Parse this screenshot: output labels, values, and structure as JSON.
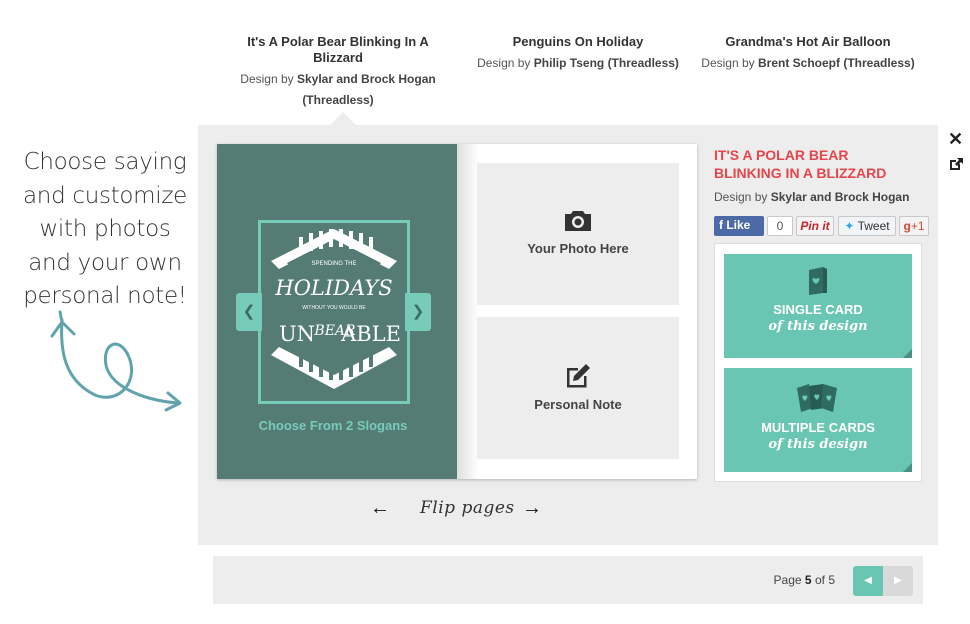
{
  "designs": [
    {
      "title": "It's A Polar Bear Blinking In A Blizzard",
      "by_prefix": "Design by",
      "designer": "Skylar and Brock Hogan (Threadless)"
    },
    {
      "title": "Penguins On Holiday",
      "by_prefix": "Design by",
      "designer": "Philip Tseng (Threadless)"
    },
    {
      "title": "Grandma's Hot Air Balloon",
      "by_prefix": "Design by",
      "designer": "Brent Schoepf (Threadless)"
    }
  ],
  "handwritten_note": "Choose saying and customize with photos and your own personal note!",
  "card_art": {
    "line1": "SPENDING THE",
    "line2": "HOLIDAYS",
    "line3": "WITHOUT YOU WOULD BE",
    "line4": "UN",
    "line5": "BEAR",
    "line6": "ABLE"
  },
  "cover": {
    "choose_label": "Choose From 2 Slogans",
    "prev_icon": "chevron-left-icon",
    "next_icon": "chevron-right-icon"
  },
  "inside": {
    "photo_label": "Your Photo Here",
    "photo_icon": "camera-icon",
    "note_label": "Personal Note",
    "note_icon": "edit-icon"
  },
  "flip": {
    "label": "Flip pages",
    "prev_icon": "arrow-left-icon",
    "next_icon": "arrow-right-icon"
  },
  "detail": {
    "title": "IT'S A POLAR BEAR BLINKING IN A BLIZZARD",
    "by_prefix": "Design by",
    "designer": "Skylar and Brock Hogan"
  },
  "social": {
    "like": "Like",
    "like_count": "0",
    "pin": "Pin it",
    "tweet": "Tweet",
    "gplus": "+1"
  },
  "buy": {
    "single_l1": "SINGLE CARD",
    "single_l2": "of this design",
    "multi_l1": "MULTIPLE CARDS",
    "multi_l2": "of this design"
  },
  "window_controls": {
    "close": "✕",
    "close_icon": "close-icon",
    "popout_icon": "external-link-icon"
  },
  "pager": {
    "prefix": "Page",
    "current": "5",
    "of": "of",
    "total": "5"
  },
  "colors": {
    "teal": "#69c6b2",
    "cover": "#557b75",
    "title_red": "#e5464b",
    "panel_bg": "#ededed"
  }
}
